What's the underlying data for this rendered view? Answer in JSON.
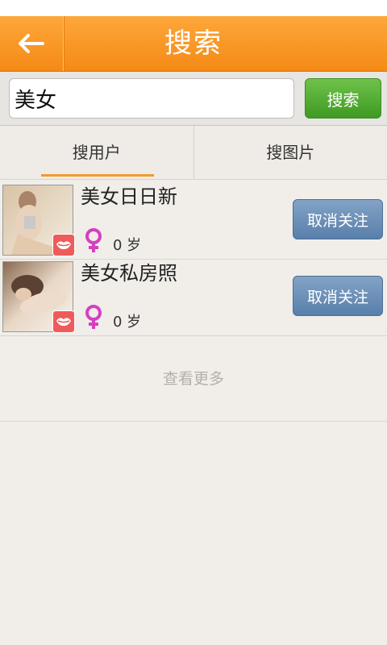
{
  "header": {
    "title": "搜索",
    "back_icon": "back-arrow-icon",
    "background": "#f7931e"
  },
  "search": {
    "value": "美女",
    "button_label": "搜索",
    "button_color": "#4da82d"
  },
  "tabs": [
    {
      "label": "搜用户",
      "selected": true
    },
    {
      "label": "搜图片",
      "selected": false
    }
  ],
  "results": [
    {
      "name": "美女日日新",
      "gender_icon": "female-icon",
      "age": "0 岁",
      "badge_icon": "lips-badge-icon",
      "action_label": "取消关注"
    },
    {
      "name": "美女私房照",
      "gender_icon": "female-icon",
      "age": "0 岁",
      "badge_icon": "lips-badge-icon",
      "action_label": "取消关注"
    }
  ],
  "more_label": "查看更多"
}
